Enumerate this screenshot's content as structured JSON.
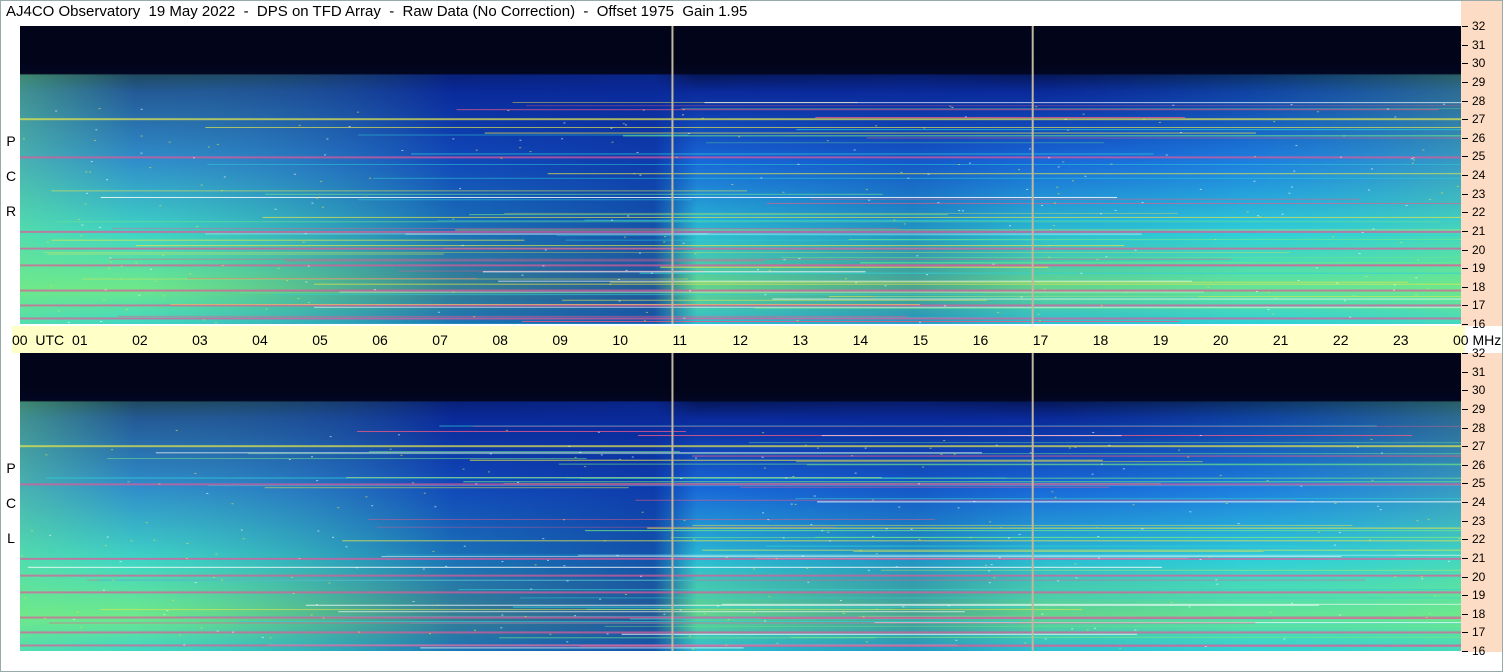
{
  "title": "AJ4CO Observatory  19 May 2022  -  DPS on TFD Array  -  Raw Data (No Correction)  -  Offset 1975  Gain 1.95",
  "panels": [
    {
      "id": "rcp",
      "label_letters": [
        "P",
        "C",
        "R"
      ]
    },
    {
      "id": "lcp",
      "label_letters": [
        "P",
        "C",
        "L"
      ]
    }
  ],
  "time_axis": {
    "labels": [
      "00  UTC",
      "01",
      "02",
      "03",
      "04",
      "05",
      "06",
      "07",
      "08",
      "09",
      "10",
      "11",
      "12",
      "13",
      "14",
      "15",
      "16",
      "17",
      "18",
      "19",
      "20",
      "21",
      "22",
      "23",
      "00 MHz"
    ]
  },
  "freq_axis": {
    "labels": [
      "32",
      "31",
      "30",
      "29",
      "28",
      "27",
      "26",
      "25",
      "24",
      "23",
      "22",
      "21",
      "20",
      "19",
      "18",
      "17",
      "16"
    ]
  },
  "colors": {
    "background_top": "#02051a",
    "deep_blue": "#0a2a9a",
    "mid_blue": "#1a6ee0",
    "cyan": "#2fd0d8",
    "green": "#6ee88a",
    "yellow": "#e8e84a",
    "marker_line": "#bfb8a0"
  },
  "chart_data": {
    "type": "heatmap",
    "title": "AJ4CO Observatory  19 May 2022  -  DPS on TFD Array  -  Raw Data (No Correction)  -  Offset 1975  Gain 1.95",
    "x_range_utc": [
      0,
      24
    ],
    "y_range_mhz": [
      16,
      32
    ],
    "panels": [
      "RCP",
      "LCP"
    ],
    "vertical_markers_utc": [
      10.85,
      16.85
    ],
    "noise_bands_mhz": [
      27.05,
      25.0,
      21.0,
      20.1,
      19.2,
      17.85,
      17.05,
      16.35
    ],
    "quiet_dark_band_mhz": [
      29.4,
      32
    ]
  }
}
